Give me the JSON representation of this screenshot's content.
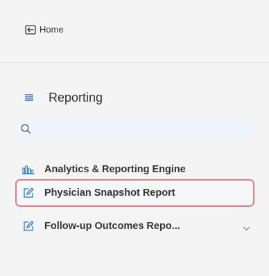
{
  "home": {
    "label": "Home"
  },
  "section": {
    "title": "Reporting"
  },
  "search": {
    "placeholder": "",
    "value": ""
  },
  "nav": {
    "items": [
      {
        "label": "Analytics & Reporting Engine",
        "icon": "bar-chart-icon"
      },
      {
        "label": "Physician Snapshot Report",
        "icon": "edit-icon",
        "selected": true
      },
      {
        "label": "Follow-up Outcomes Repo...",
        "icon": "edit-icon",
        "has_submenu": true
      }
    ]
  },
  "colors": {
    "accent": "#2b78c5",
    "selected_border": "#e57a87",
    "background": "#f4f4f4"
  }
}
